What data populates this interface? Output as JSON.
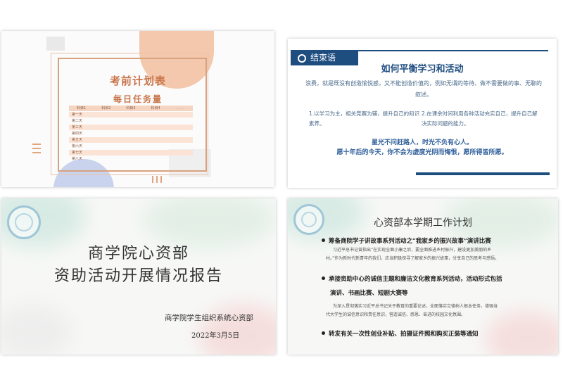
{
  "slide1": {
    "title": "考前计划表",
    "subtitle": "每日任务量",
    "columns": [
      "科目1",
      "科目2",
      "科目3",
      "科目4",
      ". . . ."
    ],
    "rows": [
      "第一天",
      "第二天",
      "第三天",
      "第四天",
      "第五天",
      "第六天",
      "第七天",
      "第八天"
    ],
    "colors": {
      "accent": "#c9754a",
      "peach": "#f3c8ac",
      "blue": "#c9d3ee"
    }
  },
  "slide2": {
    "tag": "结束语",
    "heading": "如何平衡学习和活动",
    "paragraph": "浪费，就是既没有创造愉悦感，又不能创造价值的，例如无谓的等待、做不需要做的事、无聊的叙述。",
    "col1": "1.以学习为主，相关竞赛为辅，提升自己的知识素养。",
    "col2": "2.在课余时间利用各种活动充实自己，提升自己解决实际问题的能力。",
    "highlight1": "星光不问赶路人，时光不负有心人。",
    "highlight2": "愿十年后的今天，你不会为虚度光阴而悔恨，愿所得皆所愿。",
    "colors": {
      "primary": "#1e4d80"
    }
  },
  "slide3": {
    "title_line1": "商学院心资部",
    "title_line2": "资助活动开展情况报告",
    "org": "商学院学生组织系统心资部",
    "date": "2022年3月5日"
  },
  "slide4": {
    "title": "心资部本学期工作计划",
    "bullet1": "筹备商院学子讲故事系列活动之“我家乡的振兴故事”演讲比赛",
    "sub1_line1": "习近平总书记曾指出“在实现全面小康之后，要全面推进乡村振兴，建设更加美丽的乡",
    "sub1_line2": "村。”作为新时代新青年的我们，应当积极探寻了解家乡的振兴故事，分享自己的思考与感悟。",
    "bullet2": "承接资助中心的诚信主题和廉洁文化教育系列活动，活动形式包括",
    "bullet2_cont": "演讲、书画比赛、短剧大赛等",
    "sub2_line1": "为深入贯彻落实习近平总书记关于教育的重要论述，全面落实立德树人根本任务，增强当",
    "sub2_line2": "代大学生的诚信意识和责任意识，营造诚信、感恩、奋进的校园文化氛围。",
    "bullet3": "转发有关一次性创业补贴、拍摄证件照和购买正装等通知"
  }
}
